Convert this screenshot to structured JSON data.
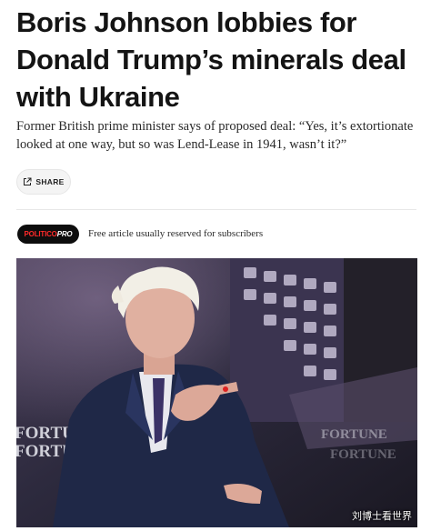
{
  "article": {
    "headline": "Boris Johnson lobbies for Donald Trump’s minerals deal with Ukraine",
    "dek": "Former British prime minister says of proposed deal: “Yes, it’s extortionate looked at one way, but so was Lend-Lease in 1941, wasn’t it?”"
  },
  "share": {
    "label": "SHARE",
    "icon": "external-share-icon"
  },
  "badge": {
    "part1": "POLITICO",
    "part2": "PRO",
    "note": "Free article usually reserved for subscribers"
  },
  "photo": {
    "backdrop_lettering": [
      "FORTU",
      "FORTUNE",
      "FORTUNE",
      "FORTUNE"
    ],
    "caption_partial": ""
  },
  "watermark": {
    "text": "刘博士看世界"
  },
  "colors": {
    "text": "#141414",
    "badge_bg": "#0d0d0d",
    "badge_accent": "#ff2a2a",
    "share_bg": "#f4f4f4"
  }
}
